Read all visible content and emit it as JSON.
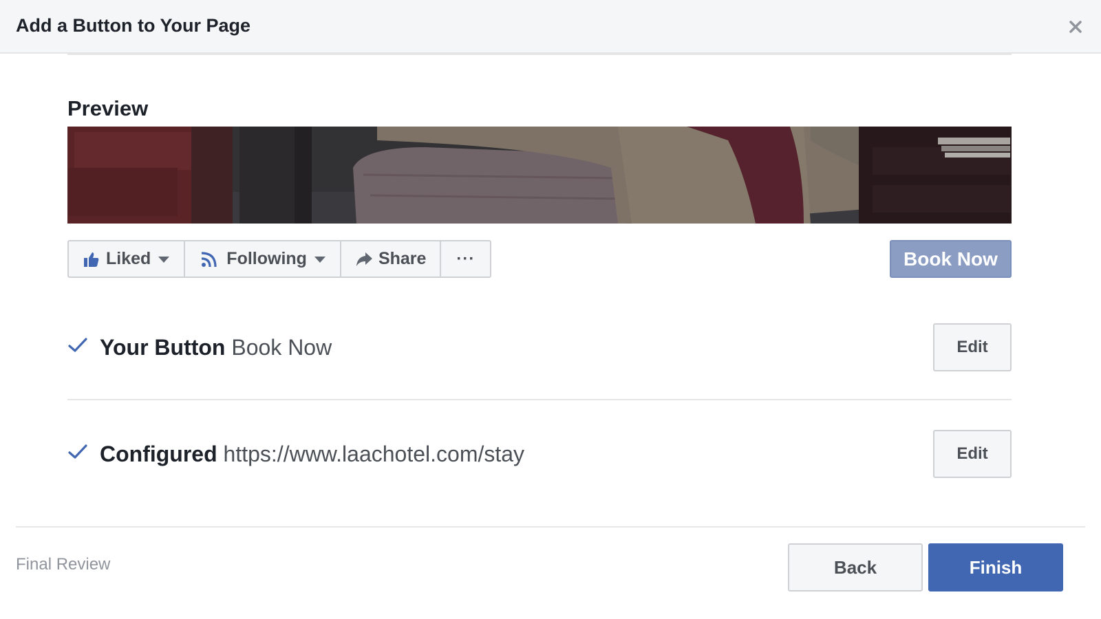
{
  "dialog": {
    "title": "Add a Button to Your Page",
    "close_icon": "close-icon"
  },
  "preview": {
    "label": "Preview",
    "actions": [
      {
        "label": "Liked",
        "icon": "thumbs-up-icon",
        "has_caret": true
      },
      {
        "label": "Following",
        "icon": "rss-icon",
        "has_caret": true
      },
      {
        "label": "Share",
        "icon": "share-arrow-icon",
        "has_caret": false
      },
      {
        "label": "···",
        "icon": "more-icon",
        "has_caret": false
      }
    ],
    "cta_button": "Book Now"
  },
  "summary": [
    {
      "title": "Your Button",
      "value": "Book Now",
      "edit_label": "Edit",
      "icon": "checkmark-icon"
    },
    {
      "title": "Configured",
      "value": "https://www.laachotel.com/stay",
      "edit_label": "Edit",
      "icon": "checkmark-icon"
    }
  ],
  "footer": {
    "step_label": "Final Review",
    "back_label": "Back",
    "finish_label": "Finish"
  },
  "colors": {
    "primary": "#4267b2",
    "cta_disabled": "#8b9dc3",
    "header_bg": "#f5f6f7",
    "check": "#4267b2"
  }
}
